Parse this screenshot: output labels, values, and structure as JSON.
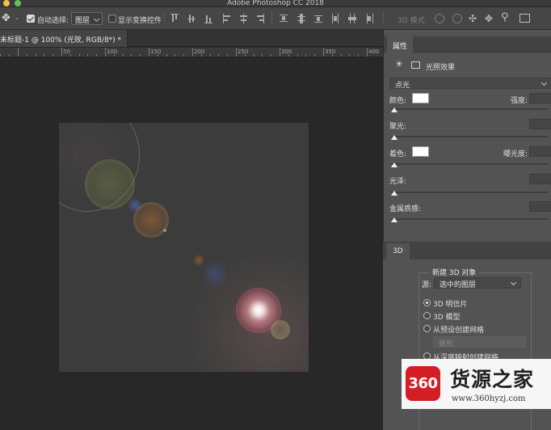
{
  "app": {
    "title": "Adobe Photoshop CC 2018"
  },
  "options_bar": {
    "auto_select_label": "自动选择:",
    "auto_select_checked": true,
    "auto_select_target": "图层",
    "show_transform_label": "显示变换控件",
    "show_transform_checked": false,
    "mode_3d_label": "3D 模式:"
  },
  "document": {
    "tab_title": "未标题-1 @ 100% (光效, RGB/8*) *"
  },
  "ruler": {
    "labels": [
      "50",
      "100",
      "150",
      "200",
      "250",
      "300",
      "350",
      "400",
      "450"
    ]
  },
  "properties_panel": {
    "tab": "属性",
    "effect_name": "光照效果",
    "light_type": "点光",
    "color_label": "颜色:",
    "color_value": "#ffffff",
    "intensity_label": "强度:",
    "hotspot_label": "聚光:",
    "colorize_label": "着色:",
    "colorize_value": "#ffffff",
    "exposure_label": "曝光度:",
    "gloss_label": "光泽:",
    "metallic_label": "金属质感:"
  },
  "panel_3d": {
    "tab": "3D",
    "group_title": "新建 3D 对象",
    "source_label": "源:",
    "source_value": "选中的图层",
    "options": [
      {
        "label": "3D 明信片",
        "selected": true
      },
      {
        "label": "3D 模型",
        "selected": false
      },
      {
        "label": "从预设创建网格",
        "selected": false
      },
      {
        "label": "从深度映射创建网格",
        "selected": false
      }
    ],
    "preset_value": "锥形"
  },
  "watermark": {
    "badge": "360",
    "name": "货源之家",
    "url": "www.360hyzj.com"
  }
}
